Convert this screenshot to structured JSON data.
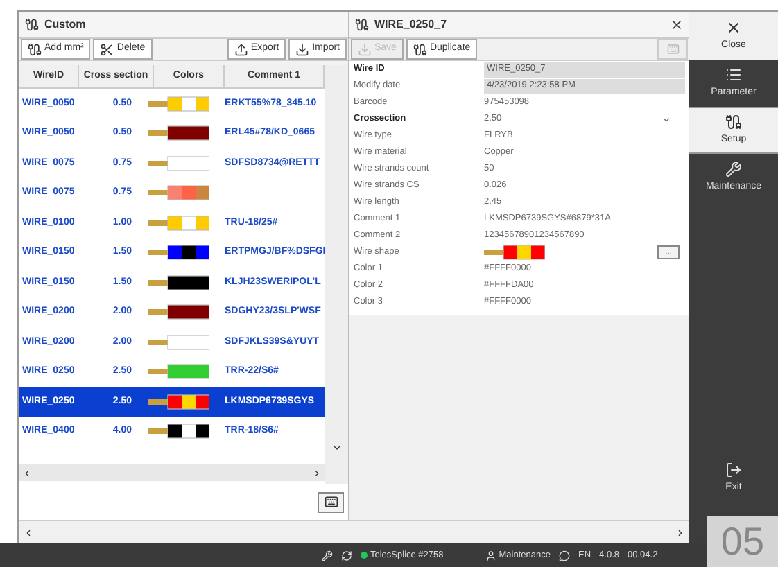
{
  "list_panel": {
    "title": "Custom",
    "toolbar": [
      {
        "label": "Add mm²",
        "kind": "add"
      },
      {
        "label": "Delete",
        "kind": "delete"
      },
      {
        "label": "Export",
        "kind": "export"
      },
      {
        "label": "Import",
        "kind": "import"
      }
    ],
    "columns": [
      "WireID",
      "Cross section",
      "Colors",
      "Comment 1"
    ],
    "rows": [
      {
        "wire_id": "WIRE_0050",
        "cross_section": "0.50",
        "stripes": [
          {
            "color": "#ffcc00"
          },
          {
            "color": "#ffffff"
          },
          {
            "color": "#ffcc00"
          }
        ],
        "comment_1": "ERKT55%78_345.10",
        "selected": false
      },
      {
        "wire_id": "WIRE_0050",
        "cross_section": "0.50",
        "stripes": [
          {
            "color": "#800000"
          }
        ],
        "comment_1": "ERL45#78/KD_0665",
        "selected": false
      },
      {
        "wire_id": "WIRE_0075",
        "cross_section": "0.75",
        "stripes": [
          {
            "color": "#ffffff"
          }
        ],
        "comment_1": "SDFSD8734@RETTT",
        "selected": false
      },
      {
        "wire_id": "WIRE_0075",
        "cross_section": "0.75",
        "stripes": [
          {
            "color": "#fa8072"
          },
          {
            "color": "#ff6347"
          },
          {
            "color": "#cd853f"
          }
        ],
        "selected": false
      },
      {
        "wire_id": "WIRE_0100",
        "cross_section": "1.00",
        "stripes": [
          {
            "color": "#ffcc00"
          },
          {
            "color": "#ffffff"
          },
          {
            "color": "#ffcc00"
          }
        ],
        "comment_1": "TRU-18/25#",
        "selected": false
      },
      {
        "wire_id": "WIRE_0150",
        "cross_section": "1.50",
        "stripes": [
          {
            "color": "#0000ff"
          },
          {
            "color": "#000000"
          },
          {
            "color": "#0000ff"
          }
        ],
        "comment_1": "ERTPMGJ/BF%DSFGI",
        "selected": false
      },
      {
        "wire_id": "WIRE_0150",
        "cross_section": "1.50",
        "stripes": [
          {
            "color": "#000000"
          }
        ],
        "comment_1": "KLJH23SWERIPOL'L",
        "selected": false
      },
      {
        "wire_id": "WIRE_0200",
        "cross_section": "2.00",
        "stripes": [
          {
            "color": "#800000"
          }
        ],
        "comment_1": "SDGHY23/3SLP'WSF",
        "selected": false
      },
      {
        "wire_id": "WIRE_0200",
        "cross_section": "2.00",
        "stripes": [
          {
            "color": "#ffffff"
          }
        ],
        "comment_1": "SDFJKLS39S&YUYT",
        "selected": false
      },
      {
        "wire_id": "WIRE_0250",
        "cross_section": "2.50",
        "stripes": [
          {
            "color": "#32cd32"
          }
        ],
        "comment_1": "TRR-22/S6#",
        "selected": false
      },
      {
        "wire_id": "WIRE_0250",
        "cross_section": "2.50",
        "stripes": [
          {
            "color": "#ff0000"
          },
          {
            "color": "#ffd700"
          },
          {
            "color": "#ff0000"
          }
        ],
        "comment_1": "LKMSDP6739SGYS",
        "selected": true
      },
      {
        "wire_id": "WIRE_0400",
        "cross_section": "4.00",
        "stripes": [
          {
            "color": "#000000"
          },
          {
            "color": "#ffffff"
          },
          {
            "color": "#000000"
          }
        ],
        "comment_1": "TRR-18/S6#",
        "selected": false
      }
    ]
  },
  "detail_panel": {
    "title": "WIRE_0250_7",
    "toolbar": [
      {
        "label": "Save",
        "kind": "save",
        "disabled": true
      },
      {
        "label": "Duplicate",
        "kind": "duplicate",
        "disabled": false
      }
    ],
    "properties": [
      {
        "label": "Wire ID",
        "value": "WIRE_0250_7",
        "kind": "readonly",
        "bold": true
      },
      {
        "label": "Modify date",
        "value": "4/23/2019 2:23:58 PM",
        "kind": "readonly",
        "bold": false
      },
      {
        "label": "Barcode",
        "value": "975453098",
        "kind": "text",
        "bold": false
      },
      {
        "label": "Crossection",
        "value": "2.50",
        "kind": "dropdown",
        "bold": true
      },
      {
        "label": "Wire type",
        "value": "FLRYB",
        "kind": "text",
        "bold": false
      },
      {
        "label": "Wire material",
        "value": "Copper",
        "kind": "text",
        "bold": false
      },
      {
        "label": "Wire strands count",
        "value": "50",
        "kind": "text",
        "bold": false
      },
      {
        "label": "Wire strands CS",
        "value": "0.026",
        "kind": "text",
        "bold": false
      },
      {
        "label": "Wire length",
        "value": "2.45",
        "kind": "text",
        "bold": false
      },
      {
        "label": "Comment 1",
        "value": "LKMSDP6739SGYS#6879*31A",
        "kind": "text",
        "bold": false
      },
      {
        "label": "Comment 2",
        "value": "12345678901234567890",
        "kind": "text",
        "bold": false
      },
      {
        "label": "Wire shape",
        "stripes": [
          {
            "color": "#ff0000"
          },
          {
            "color": "#ffd700"
          },
          {
            "color": "#ff0000"
          }
        ],
        "action": "...",
        "kind": "shape",
        "bold": false
      },
      {
        "label": "Color 1",
        "value": "#FFFF0000",
        "kind": "text",
        "bold": false
      },
      {
        "label": "Color 2",
        "value": "#FFFFDA00",
        "kind": "text",
        "bold": false
      },
      {
        "label": "Color 3",
        "value": "#FFFF0000",
        "kind": "text",
        "bold": false
      }
    ]
  },
  "sidebar": [
    {
      "label": "Close",
      "kind": "close",
      "selected": false
    },
    {
      "label": "Parameter",
      "kind": "parameter",
      "selected": false
    },
    {
      "label": "Setup",
      "kind": "setup",
      "selected": true
    },
    {
      "label": "Maintenance",
      "kind": "maintenance",
      "selected": false
    },
    {
      "label": "Exit",
      "kind": "exit",
      "selected": false
    }
  ],
  "status_bar": {
    "device": "TelesSplice #2758",
    "online": true,
    "user": "Maintenance",
    "language": "EN",
    "version": "4.0.8",
    "date": "00.04.2"
  },
  "figure_label": "05"
}
